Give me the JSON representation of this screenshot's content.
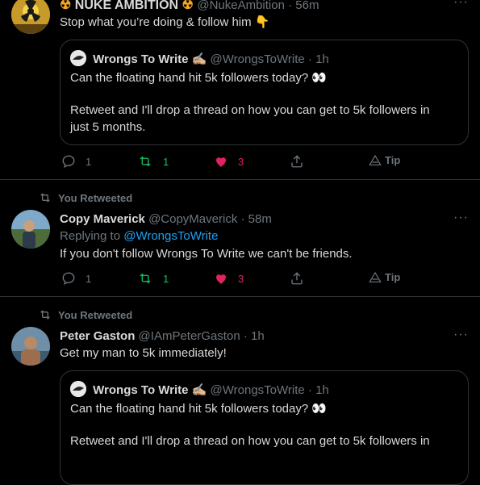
{
  "tweets": [
    {
      "name": "NUKE AMBITION",
      "name_emoji": "☢",
      "handle": "@NukeAmbition",
      "time": "· 56m",
      "text": "Stop what you’re doing & follow him 👇",
      "quote": {
        "name": "Wrongs To Write",
        "name_emoji": "✍🏼",
        "handle": "@WrongsToWrite",
        "time": "· 1h",
        "line1": "Can the floating hand hit 5k followers today? 👀",
        "line2": "Retweet and I'll drop a thread on how you can get to 5k followers in",
        "line3": "just 5 months."
      },
      "actions": {
        "replies": "1",
        "retweets": "1",
        "likes": "3",
        "tip": "Tip"
      }
    },
    {
      "retweeted_label": "You Retweeted",
      "name": "Copy Maverick",
      "handle": "@CopyMaverick",
      "time": "· 58m",
      "replying_prefix": "Replying to",
      "replying_to": "@WrongsToWrite",
      "text": "If you don't follow Wrongs To Write we can't be friends.",
      "actions": {
        "replies": "1",
        "retweets": "1",
        "likes": "3",
        "tip": "Tip"
      }
    },
    {
      "retweeted_label": "You Retweeted",
      "name": "Peter Gaston",
      "handle": "@IAmPeterGaston",
      "time": "· 1h",
      "text": "Get my man to 5k immediately!",
      "quote": {
        "name": "Wrongs To Write",
        "name_emoji": "✍🏼",
        "handle": "@WrongsToWrite",
        "time": "· 1h",
        "line1": "Can the floating hand hit 5k followers today? 👀",
        "line2": "Retweet and I'll drop a thread on how you can get to 5k followers in"
      }
    }
  ],
  "more_glyph": "···",
  "colors": {
    "background": "#000000",
    "text": "#d9d9d9",
    "muted": "#6e767d",
    "link": "#1da1f2",
    "retweet_green": "#17bf63",
    "like_pink": "#e0245e",
    "border": "#2f3336"
  }
}
